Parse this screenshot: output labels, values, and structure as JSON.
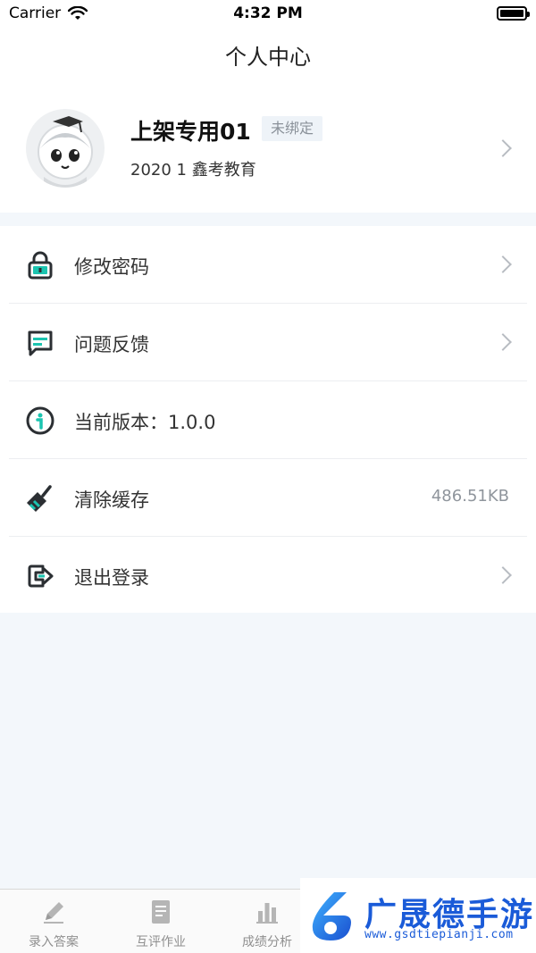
{
  "status_bar": {
    "carrier": "Carrier",
    "time": "4:32 PM"
  },
  "nav": {
    "title": "个人中心"
  },
  "profile": {
    "name": "上架专用01",
    "badge": "未绑定",
    "subtitle": "2020 1 鑫考教育"
  },
  "menu": {
    "items": [
      {
        "label": "修改密码",
        "icon": "lock-icon"
      },
      {
        "label": "问题反馈",
        "icon": "feedback-icon"
      },
      {
        "label": "当前版本：1.0.0",
        "icon": "info-icon"
      },
      {
        "label": "清除缓存",
        "icon": "broom-icon",
        "value": "486.51KB"
      },
      {
        "label": "退出登录",
        "icon": "logout-icon"
      }
    ]
  },
  "tab_bar": {
    "tabs": [
      {
        "label": "录入答案",
        "icon": "pencil-icon"
      },
      {
        "label": "互评作业",
        "icon": "document-icon"
      },
      {
        "label": "成绩分析",
        "icon": "bar-chart-icon"
      }
    ]
  },
  "watermark": {
    "text": "广晟德手游",
    "url": "www.gsdtiepianji.com"
  },
  "colors": {
    "accent": "#1bc4b0",
    "icon_dark": "#2b2f33",
    "background": "#f3f7fb"
  }
}
